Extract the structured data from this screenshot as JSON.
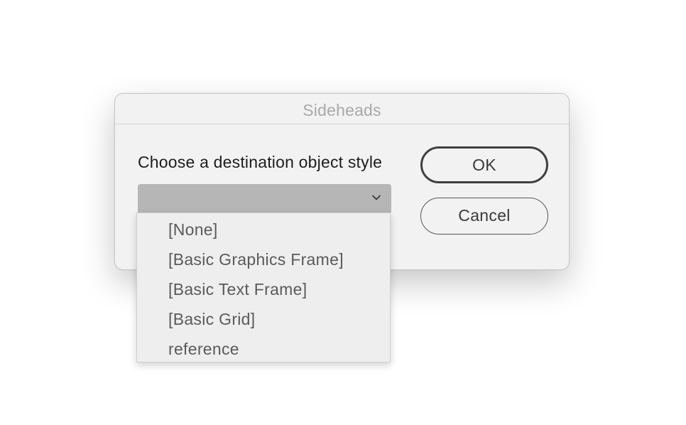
{
  "dialog": {
    "title": "Sideheads",
    "prompt": "Choose a destination object style",
    "select": {
      "selected": "",
      "chevron_icon": "chevron-down-icon"
    },
    "ok_label": "OK",
    "cancel_label": "Cancel"
  },
  "dropdown": {
    "options": [
      "[None]",
      "[Basic Graphics Frame]",
      "[Basic Text Frame]",
      "[Basic Grid]",
      "reference"
    ]
  }
}
